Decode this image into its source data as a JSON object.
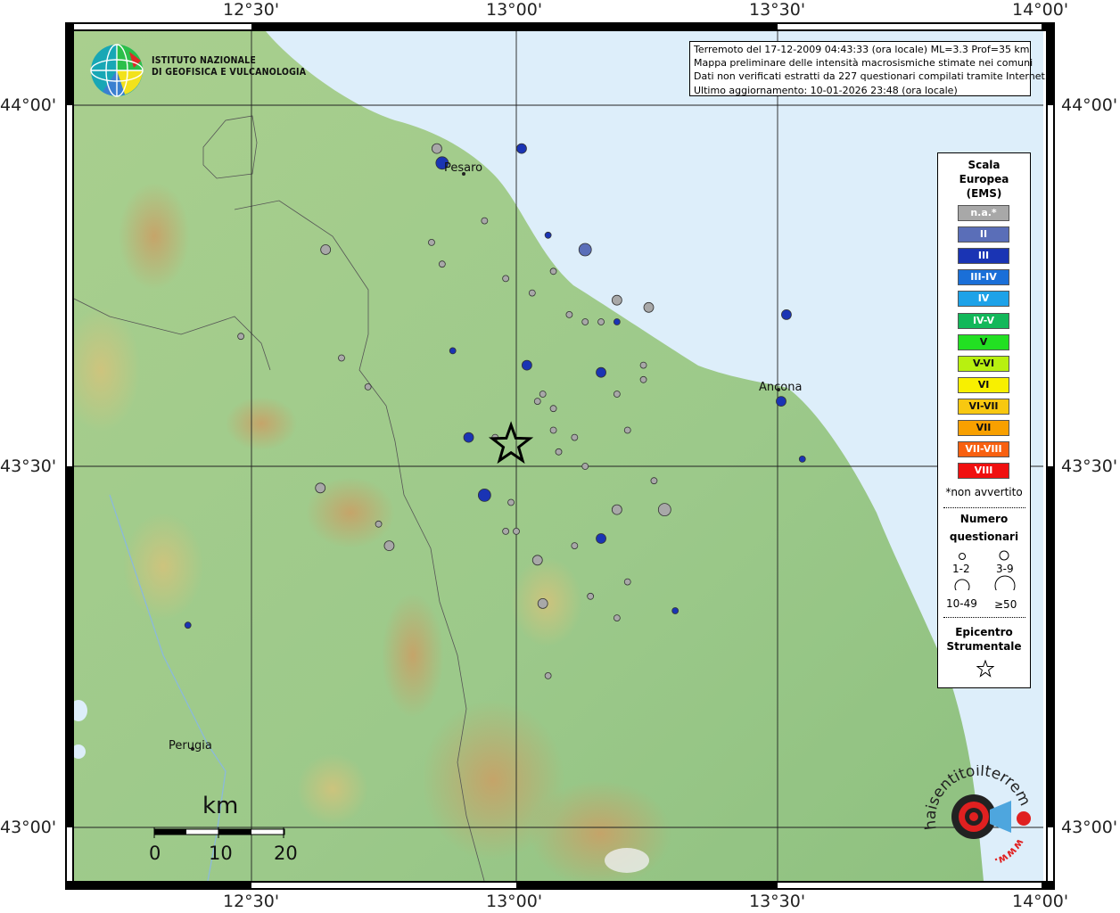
{
  "header": {
    "lines": [
      "Terremoto del 17-12-2009 04:43:33 (ora locale) ML=3.3 Prof=35 km",
      "Mappa preliminare delle intensità macrosismiche stimate nei comuni",
      "Dati non verificati estratti da 227 questionari compilati tramite Internet.",
      "Ultimo aggiornamento: 10-01-2026 23:48 (ora locale)"
    ]
  },
  "logo": {
    "line1": "ISTITUTO NAZIONALE",
    "line2": "DI GEOFISICA E VULCANOLOGIA"
  },
  "axes": {
    "top": [
      "12°30'",
      "13°00'",
      "13°30'",
      "14°00'"
    ],
    "bottom": [
      "12°30'",
      "13°00'",
      "13°30'",
      "14°00'"
    ],
    "left": [
      "44°00'",
      "43°30'",
      "43°00'"
    ],
    "right": [
      "44°00'",
      "43°30'",
      "43°00'"
    ]
  },
  "cities": [
    "Pesaro",
    "Ancona",
    "Perugia"
  ],
  "scale_bar": {
    "unit": "km",
    "ticks": [
      "0",
      "10",
      "20"
    ]
  },
  "legend": {
    "title": [
      "Scala",
      "Europea",
      "(EMS)"
    ],
    "classes": [
      {
        "label": "n.a.*",
        "color": "#a8a8a8"
      },
      {
        "label": "II",
        "color": "#5a6eb8"
      },
      {
        "label": "III",
        "color": "#1a34b4"
      },
      {
        "label": "III-IV",
        "color": "#1a6fd8"
      },
      {
        "label": "IV",
        "color": "#1da2e8"
      },
      {
        "label": "IV-V",
        "color": "#12b85a"
      },
      {
        "label": "V",
        "color": "#22e022"
      },
      {
        "label": "V-VI",
        "color": "#b8f010"
      },
      {
        "label": "VI",
        "color": "#f8f000"
      },
      {
        "label": "VI-VII",
        "color": "#f8c810"
      },
      {
        "label": "VII",
        "color": "#f8a000"
      },
      {
        "label": "VII-VIII",
        "color": "#f86010"
      },
      {
        "label": "VIII",
        "color": "#f01010"
      }
    ],
    "note": "*non avvertito",
    "size_title": [
      "Numero",
      "questionari"
    ],
    "sizes": [
      "1-2",
      "3-9",
      "10-49",
      "≥50"
    ],
    "epi_title": [
      "Epicentro",
      "Strumentale"
    ]
  },
  "stamp": {
    "text": "haisentitoilterremoto.it",
    "url": "www."
  },
  "colors": {
    "sea": "#ddeefa",
    "land": "#9cc98a",
    "grey_point": "#a8a8a8",
    "blue_point": "#1a34b4",
    "blue2": "#5a6eb8"
  },
  "points": [
    {
      "lon": 12.85,
      "lat": 43.94,
      "n": "3-9",
      "cls": "n.a."
    },
    {
      "lon": 12.86,
      "lat": 43.92,
      "n": "10-49",
      "cls": "III"
    },
    {
      "lon": 13.01,
      "lat": 43.94,
      "n": "3-9",
      "cls": "III"
    },
    {
      "lon": 12.94,
      "lat": 43.84,
      "n": "1-2",
      "cls": "n.a."
    },
    {
      "lon": 13.06,
      "lat": 43.82,
      "n": "1-2",
      "cls": "III"
    },
    {
      "lon": 12.84,
      "lat": 43.81,
      "n": "1-2",
      "cls": "n.a."
    },
    {
      "lon": 12.64,
      "lat": 43.8,
      "n": "3-9",
      "cls": "n.a."
    },
    {
      "lon": 13.13,
      "lat": 43.8,
      "n": "10-49",
      "cls": "II"
    },
    {
      "lon": 12.86,
      "lat": 43.78,
      "n": "1-2",
      "cls": "n.a."
    },
    {
      "lon": 12.98,
      "lat": 43.76,
      "n": "1-2",
      "cls": "n.a."
    },
    {
      "lon": 13.07,
      "lat": 43.77,
      "n": "1-2",
      "cls": "n.a."
    },
    {
      "lon": 13.03,
      "lat": 43.74,
      "n": "1-2",
      "cls": "n.a."
    },
    {
      "lon": 13.19,
      "lat": 43.73,
      "n": "3-9",
      "cls": "n.a."
    },
    {
      "lon": 13.25,
      "lat": 43.72,
      "n": "3-9",
      "cls": "n.a."
    },
    {
      "lon": 13.1,
      "lat": 43.71,
      "n": "1-2",
      "cls": "n.a."
    },
    {
      "lon": 13.13,
      "lat": 43.7,
      "n": "1-2",
      "cls": "n.a."
    },
    {
      "lon": 13.16,
      "lat": 43.7,
      "n": "1-2",
      "cls": "n.a."
    },
    {
      "lon": 13.19,
      "lat": 43.7,
      "n": "1-2",
      "cls": "III"
    },
    {
      "lon": 13.51,
      "lat": 43.71,
      "n": "3-9",
      "cls": "III"
    },
    {
      "lon": 12.48,
      "lat": 43.68,
      "n": "1-2",
      "cls": "n.a."
    },
    {
      "lon": 12.88,
      "lat": 43.66,
      "n": "1-2",
      "cls": "III"
    },
    {
      "lon": 12.67,
      "lat": 43.65,
      "n": "1-2",
      "cls": "n.a."
    },
    {
      "lon": 13.02,
      "lat": 43.64,
      "n": "3-9",
      "cls": "III"
    },
    {
      "lon": 13.24,
      "lat": 43.64,
      "n": "1-2",
      "cls": "n.a."
    },
    {
      "lon": 13.16,
      "lat": 43.63,
      "n": "3-9",
      "cls": "III"
    },
    {
      "lon": 13.24,
      "lat": 43.62,
      "n": "1-2",
      "cls": "n.a."
    },
    {
      "lon": 12.72,
      "lat": 43.61,
      "n": "1-2",
      "cls": "n.a."
    },
    {
      "lon": 13.05,
      "lat": 43.6,
      "n": "1-2",
      "cls": "n.a."
    },
    {
      "lon": 13.19,
      "lat": 43.6,
      "n": "1-2",
      "cls": "n.a."
    },
    {
      "lon": 13.04,
      "lat": 43.59,
      "n": "1-2",
      "cls": "n.a."
    },
    {
      "lon": 13.07,
      "lat": 43.58,
      "n": "1-2",
      "cls": "n.a."
    },
    {
      "lon": 13.5,
      "lat": 43.59,
      "n": "3-9",
      "cls": "III"
    },
    {
      "lon": 12.91,
      "lat": 43.54,
      "n": "3-9",
      "cls": "III"
    },
    {
      "lon": 12.96,
      "lat": 43.54,
      "n": "1-2",
      "cls": "n.a."
    },
    {
      "lon": 13.07,
      "lat": 43.55,
      "n": "1-2",
      "cls": "n.a."
    },
    {
      "lon": 13.11,
      "lat": 43.54,
      "n": "1-2",
      "cls": "n.a."
    },
    {
      "lon": 13.21,
      "lat": 43.55,
      "n": "1-2",
      "cls": "n.a."
    },
    {
      "lon": 13.08,
      "lat": 43.52,
      "n": "1-2",
      "cls": "n.a."
    },
    {
      "lon": 13.13,
      "lat": 43.5,
      "n": "1-2",
      "cls": "n.a."
    },
    {
      "lon": 13.54,
      "lat": 43.51,
      "n": "1-2",
      "cls": "III"
    },
    {
      "lon": 13.26,
      "lat": 43.48,
      "n": "1-2",
      "cls": "n.a."
    },
    {
      "lon": 12.63,
      "lat": 43.47,
      "n": "3-9",
      "cls": "n.a."
    },
    {
      "lon": 12.94,
      "lat": 43.46,
      "n": "10-49",
      "cls": "III"
    },
    {
      "lon": 12.99,
      "lat": 43.45,
      "n": "1-2",
      "cls": "n.a."
    },
    {
      "lon": 13.19,
      "lat": 43.44,
      "n": "3-9",
      "cls": "n.a."
    },
    {
      "lon": 13.28,
      "lat": 43.44,
      "n": "10-49",
      "cls": "n.a."
    },
    {
      "lon": 12.74,
      "lat": 43.42,
      "n": "1-2",
      "cls": "n.a."
    },
    {
      "lon": 12.98,
      "lat": 43.41,
      "n": "1-2",
      "cls": "n.a."
    },
    {
      "lon": 13.0,
      "lat": 43.41,
      "n": "1-2",
      "cls": "n.a."
    },
    {
      "lon": 13.16,
      "lat": 43.4,
      "n": "3-9",
      "cls": "III"
    },
    {
      "lon": 12.76,
      "lat": 43.39,
      "n": "3-9",
      "cls": "n.a."
    },
    {
      "lon": 13.11,
      "lat": 43.39,
      "n": "1-2",
      "cls": "n.a."
    },
    {
      "lon": 13.04,
      "lat": 43.37,
      "n": "3-9",
      "cls": "n.a."
    },
    {
      "lon": 13.21,
      "lat": 43.34,
      "n": "1-2",
      "cls": "n.a."
    },
    {
      "lon": 13.05,
      "lat": 43.31,
      "n": "3-9",
      "cls": "n.a."
    },
    {
      "lon": 13.14,
      "lat": 43.32,
      "n": "1-2",
      "cls": "n.a."
    },
    {
      "lon": 13.3,
      "lat": 43.3,
      "n": "1-2",
      "cls": "III"
    },
    {
      "lon": 13.19,
      "lat": 43.29,
      "n": "1-2",
      "cls": "n.a."
    },
    {
      "lon": 12.38,
      "lat": 43.28,
      "n": "1-2",
      "cls": "III"
    },
    {
      "lon": 13.06,
      "lat": 43.21,
      "n": "1-2",
      "cls": "n.a."
    }
  ],
  "epicenter": {
    "lon": 12.99,
    "lat": 43.53
  }
}
